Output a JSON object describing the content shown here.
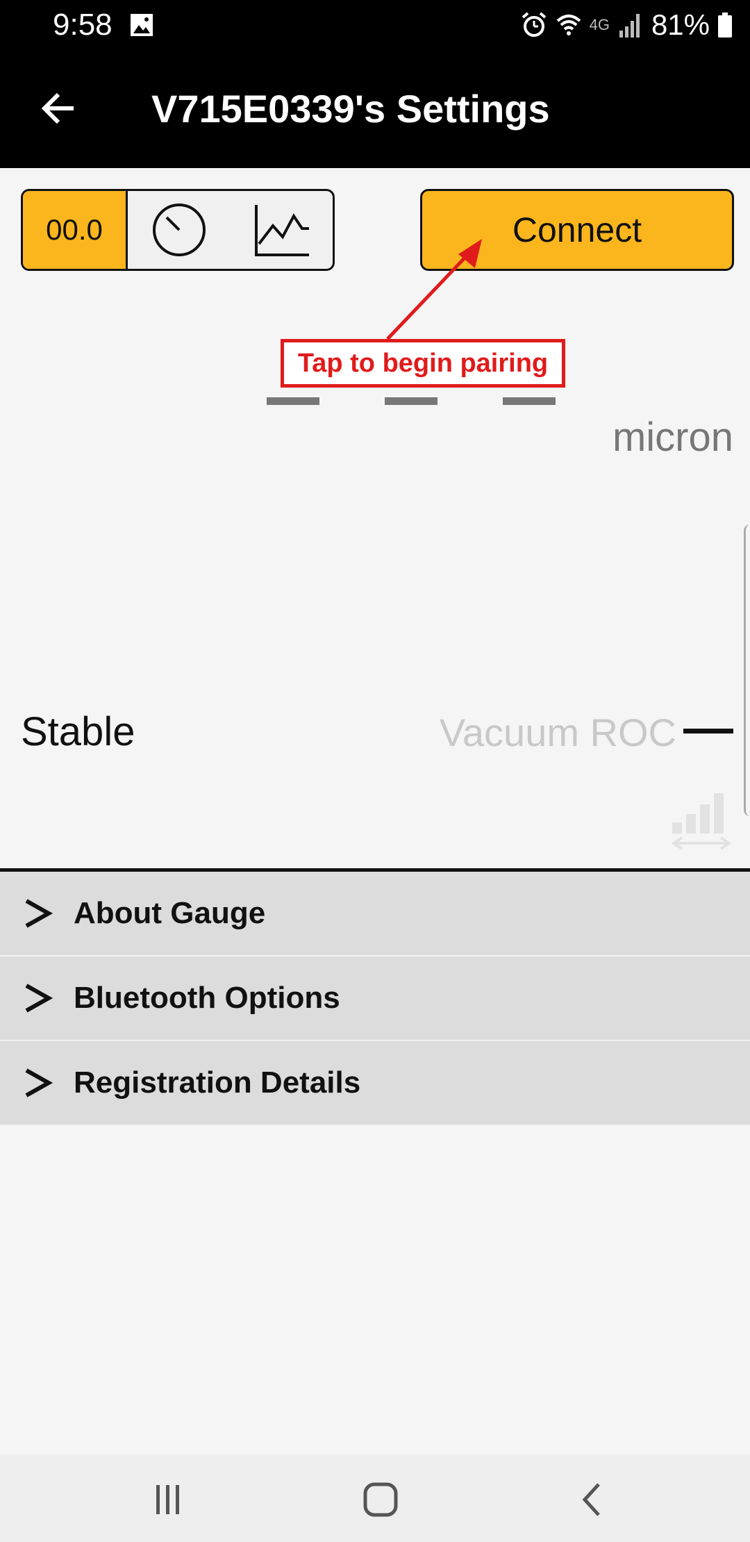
{
  "status_bar": {
    "time": "9:58",
    "battery_percent": "81%",
    "network": "4G"
  },
  "app_bar": {
    "title": "V715E0339's Settings"
  },
  "mode_selector": {
    "digital_label": "00.0"
  },
  "connect_button": {
    "label": "Connect"
  },
  "annotation": {
    "text": "Tap to begin pairing",
    "color": "#e01b1b"
  },
  "reading": {
    "unit": "micron"
  },
  "status": {
    "stability": "Stable",
    "roc_label": "Vacuum ROC"
  },
  "settings_list": [
    {
      "label": "About Gauge"
    },
    {
      "label": "Bluetooth Options"
    },
    {
      "label": "Registration Details"
    }
  ],
  "colors": {
    "accent": "#fbb61d",
    "header": "#000000",
    "list_bg": "#dcdcdc"
  }
}
